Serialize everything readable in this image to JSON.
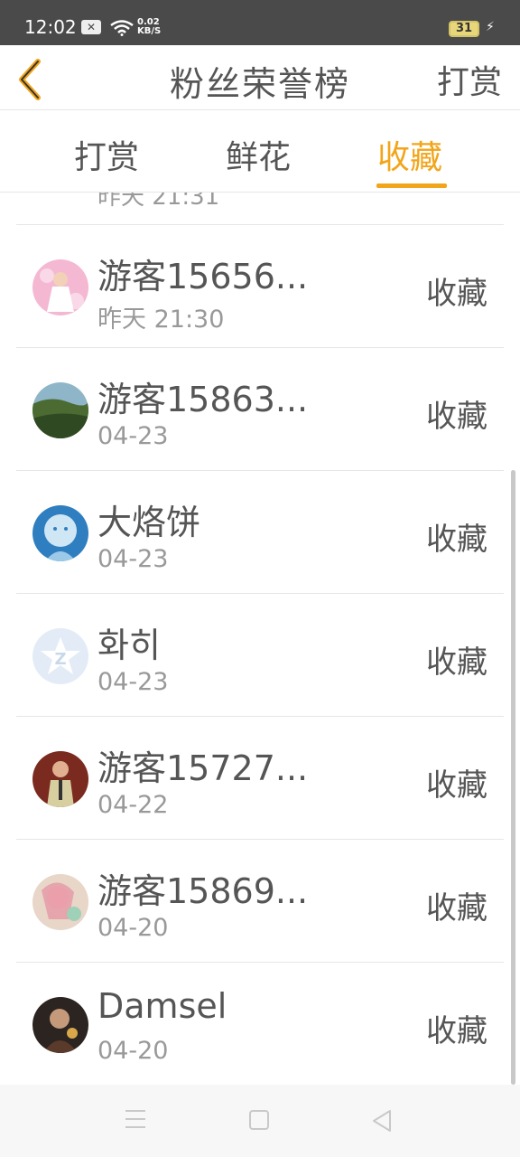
{
  "status": {
    "time": "12:02",
    "net_speed_value": "0.02",
    "net_speed_unit": "KB/S",
    "battery": "31"
  },
  "header": {
    "title": "粉丝荣誉榜",
    "action_label": "打赏"
  },
  "tabs": [
    {
      "label": "打赏"
    },
    {
      "label": "鲜花"
    },
    {
      "label": "收藏"
    }
  ],
  "active_tab": 2,
  "partial_row": {
    "date": "昨天 21:31"
  },
  "rows": [
    {
      "name": "游客15656...",
      "date": "昨天 21:30",
      "action": "收藏"
    },
    {
      "name": "游客15863...",
      "date": "04-23",
      "action": "收藏"
    },
    {
      "name": "大烙饼",
      "date": "04-23",
      "action": "收藏"
    },
    {
      "name": "화히",
      "date": "04-23",
      "action": "收藏"
    },
    {
      "name": "游客15727...",
      "date": "04-22",
      "action": "收藏"
    },
    {
      "name": "游客15869...",
      "date": "04-20",
      "action": "收藏"
    },
    {
      "name": "Damsel",
      "date": "04-20",
      "action": "收藏"
    }
  ],
  "colors": {
    "accent": "#f2a51a",
    "text": "#555555",
    "subtext": "#999999"
  }
}
